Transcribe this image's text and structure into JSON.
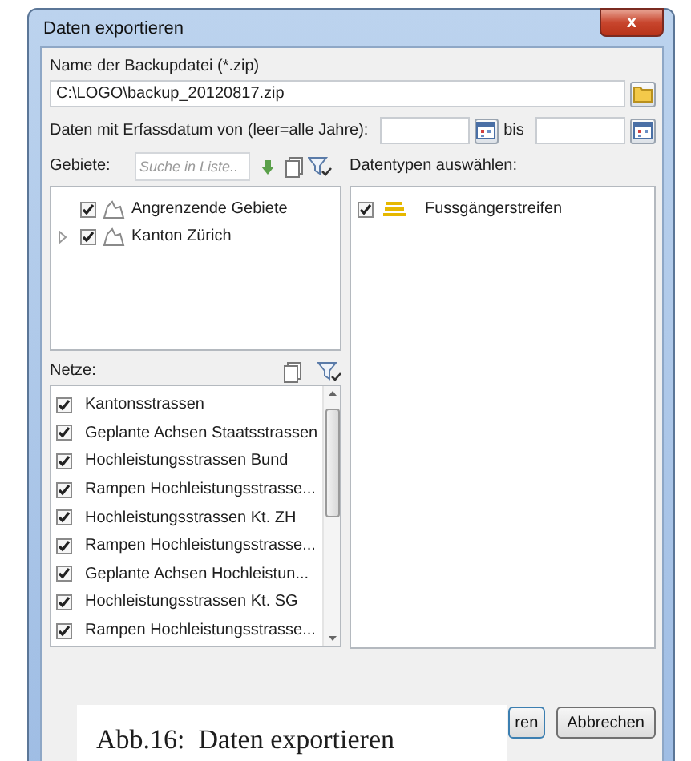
{
  "window": {
    "title": "Daten exportieren",
    "close_label": "x"
  },
  "backup_file": {
    "label": "Name der Backupdatei (*.zip)",
    "value": "C:\\LOGO\\backup_20120817.zip"
  },
  "date_range": {
    "label": "Daten mit Erfassdatum von (leer=alle Jahre):",
    "separator": "bis"
  },
  "areas": {
    "label": "Gebiete:",
    "search_placeholder": "Suche in Liste..",
    "items": [
      {
        "label": "Angrenzende Gebiete",
        "kind": "leaf",
        "checked": true
      },
      {
        "label": "Kanton Zürich",
        "kind": "branch",
        "checked": true,
        "expanded": false
      }
    ]
  },
  "data_types": {
    "label": "Datentypen auswählen:",
    "items": [
      {
        "label": "Fussgängerstreifen",
        "checked": true
      }
    ]
  },
  "networks": {
    "label": "Netze:",
    "items": [
      {
        "label": "Kantonsstrassen",
        "checked": true
      },
      {
        "label": "Geplante Achsen Staatsstrassen",
        "checked": true
      },
      {
        "label": "Hochleistungsstrassen Bund",
        "checked": true
      },
      {
        "label": "Rampen Hochleistungsstrasse...",
        "checked": true
      },
      {
        "label": "Hochleistungsstrassen Kt. ZH",
        "checked": true
      },
      {
        "label": "Rampen Hochleistungsstrasse...",
        "checked": true
      },
      {
        "label": "Geplante Achsen Hochleistun...",
        "checked": true
      },
      {
        "label": "Hochleistungsstrassen Kt. SG",
        "checked": true
      },
      {
        "label": "Rampen Hochleistungsstrasse...",
        "checked": true
      }
    ]
  },
  "buttons": [
    "ren",
    "Abbrechen"
  ],
  "caption": "Abb.16:  Daten exportieren"
}
